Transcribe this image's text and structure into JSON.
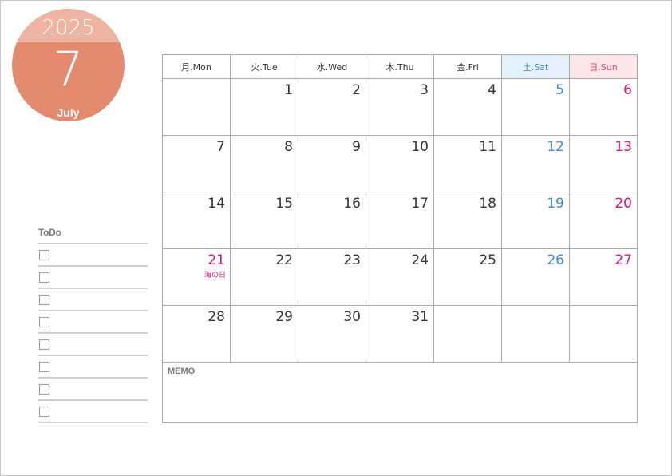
{
  "badge": {
    "year": "2025",
    "month_number": "7",
    "month_name": "July",
    "colors": {
      "top": "#eeb4a1",
      "body": "#e48a6f"
    }
  },
  "todo": {
    "title": "ToDo",
    "item_count": 8
  },
  "calendar": {
    "headers": [
      {
        "label": "月.Mon",
        "type": "weekday"
      },
      {
        "label": "火.Tue",
        "type": "weekday"
      },
      {
        "label": "水.Wed",
        "type": "weekday"
      },
      {
        "label": "木.Thu",
        "type": "weekday"
      },
      {
        "label": "金.Fri",
        "type": "weekday"
      },
      {
        "label": "土.Sat",
        "type": "sat"
      },
      {
        "label": "日.Sun",
        "type": "sun"
      }
    ],
    "weeks": [
      [
        {
          "day": ""
        },
        {
          "day": "1"
        },
        {
          "day": "2"
        },
        {
          "day": "3"
        },
        {
          "day": "4"
        },
        {
          "day": "5"
        },
        {
          "day": "6"
        }
      ],
      [
        {
          "day": "7"
        },
        {
          "day": "8"
        },
        {
          "day": "9"
        },
        {
          "day": "10"
        },
        {
          "day": "11"
        },
        {
          "day": "12"
        },
        {
          "day": "13"
        }
      ],
      [
        {
          "day": "14"
        },
        {
          "day": "15"
        },
        {
          "day": "16"
        },
        {
          "day": "17"
        },
        {
          "day": "18"
        },
        {
          "day": "19"
        },
        {
          "day": "20"
        }
      ],
      [
        {
          "day": "21",
          "holiday": "海の日"
        },
        {
          "day": "22"
        },
        {
          "day": "23"
        },
        {
          "day": "24"
        },
        {
          "day": "25"
        },
        {
          "day": "26"
        },
        {
          "day": "27"
        }
      ],
      [
        {
          "day": "28"
        },
        {
          "day": "29"
        },
        {
          "day": "30"
        },
        {
          "day": "31"
        },
        {
          "day": ""
        },
        {
          "day": ""
        },
        {
          "day": ""
        }
      ]
    ],
    "memo_label": "MEMO",
    "colors": {
      "saturday": "#3d8ad0",
      "sunday_holiday": "#e0127f",
      "weekday": "#333333"
    }
  }
}
